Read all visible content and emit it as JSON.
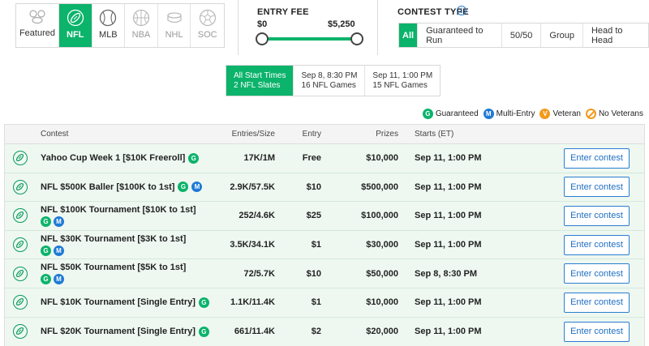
{
  "sports": [
    {
      "key": "featured",
      "label": "Featured"
    },
    {
      "key": "nfl",
      "label": "NFL"
    },
    {
      "key": "mlb",
      "label": "MLB"
    },
    {
      "key": "nba",
      "label": "NBA"
    },
    {
      "key": "nhl",
      "label": "NHL"
    },
    {
      "key": "soc",
      "label": "SOC"
    }
  ],
  "entry_fee": {
    "title": "ENTRY FEE",
    "min": "$0",
    "max": "$5,250"
  },
  "contest_type": {
    "title": "CONTEST TYPE",
    "options": [
      "All",
      "Guaranteed to Run",
      "50/50",
      "Group",
      "Head to Head"
    ],
    "selected": "All"
  },
  "start_times": [
    {
      "line1": "All Start Times",
      "line2": "2 NFL Slates"
    },
    {
      "line1": "Sep 8, 8:30 PM",
      "line2": "16 NFL Games"
    },
    {
      "line1": "Sep 11, 1:00 PM",
      "line2": "15 NFL Games"
    }
  ],
  "legend": {
    "guaranteed": "Guaranteed",
    "multi_entry": "Multi-Entry",
    "veteran": "Veteran",
    "no_veterans": "No Veterans",
    "g_letter": "G",
    "m_letter": "M",
    "v_letter": "V"
  },
  "table": {
    "headers": {
      "contest": "Contest",
      "entries": "Entries/Size",
      "entry": "Entry",
      "prizes": "Prizes",
      "starts": "Starts (ET)"
    },
    "button_label": "Enter contest",
    "rows": [
      {
        "name": "Yahoo Cup Week 1 [$10K Freeroll]",
        "entries": "17K/1M",
        "entry": "Free",
        "prizes": "$10,000",
        "starts": "Sep 11, 1:00 PM"
      },
      {
        "name": "NFL $500K Baller [$100K to 1st]",
        "entries": "2.9K/57.5K",
        "entry": "$10",
        "prizes": "$500,000",
        "starts": "Sep 11, 1:00 PM"
      },
      {
        "name": "NFL $100K Tournament [$10K to 1st]",
        "entries": "252/4.6K",
        "entry": "$25",
        "prizes": "$100,000",
        "starts": "Sep 11, 1:00 PM"
      },
      {
        "name": "NFL $30K Tournament [$3K to 1st]",
        "entries": "3.5K/34.1K",
        "entry": "$1",
        "prizes": "$30,000",
        "starts": "Sep 11, 1:00 PM"
      },
      {
        "name": "NFL $50K Tournament [$5K to 1st]",
        "entries": "72/5.7K",
        "entry": "$10",
        "prizes": "$50,000",
        "starts": "Sep 8, 8:30 PM"
      },
      {
        "name": "NFL $10K Tournament [Single Entry]",
        "entries": "1.1K/11.4K",
        "entry": "$1",
        "prizes": "$10,000",
        "starts": "Sep 11, 1:00 PM"
      },
      {
        "name": "NFL $20K Tournament [Single Entry]",
        "entries": "661/11.4K",
        "entry": "$2",
        "prizes": "$20,000",
        "starts": "Sep 11, 1:00 PM"
      }
    ]
  }
}
